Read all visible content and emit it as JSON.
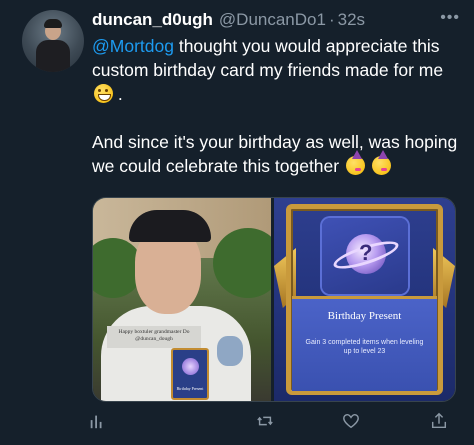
{
  "tweet": {
    "display_name": "duncan_d0ugh",
    "handle": "@DuncanDo1",
    "separator": "·",
    "time": "32s",
    "more_label": "•••",
    "paragraph1": {
      "mention": "@Mortdog",
      "text": " thought you would appreciate this custom birthday card my friends made for me ",
      "end": "."
    },
    "paragraph2": {
      "text": "And since it's your birthday as well, was hoping we could celebrate this together "
    },
    "emojis": [
      "grinning-face",
      "partying-face",
      "partying-face"
    ]
  },
  "media": {
    "held_card_caption_line1": "Happy boxtuler grandmaster Do",
    "held_card_caption_line2": "@duncan_dough",
    "mini_card_label": "Birthday Present",
    "card_title": "Birthday Present",
    "card_description": "Gain 3 completed items when leveling up to level 23"
  },
  "actions": [
    {
      "name": "analytics",
      "icon": "bar-chart-icon"
    },
    {
      "name": "retweet",
      "icon": "retweet-icon"
    },
    {
      "name": "like",
      "icon": "heart-icon"
    },
    {
      "name": "share",
      "icon": "share-icon"
    }
  ],
  "colors": {
    "background": "#15202b",
    "text": "#ffffff",
    "secondary_text": "#8b98a5",
    "link": "#1d9bf0",
    "card_gold": "#c99a3c",
    "card_blue": "#2e3f8f"
  }
}
